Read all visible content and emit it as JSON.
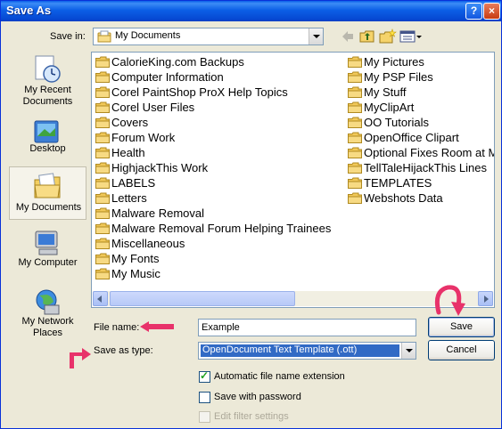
{
  "window": {
    "title": "Save As",
    "help_button": "?",
    "close_button": "×"
  },
  "toolbar": {
    "save_in_label": "Save in:",
    "save_in_value": "My Documents",
    "icons": [
      "back-icon",
      "up-folder-icon",
      "new-folder-icon",
      "views-menu-icon"
    ]
  },
  "places": [
    {
      "label": "My Recent Documents",
      "icon": "recent-documents-icon"
    },
    {
      "label": "Desktop",
      "icon": "desktop-icon"
    },
    {
      "label": "My Documents",
      "icon": "my-documents-icon",
      "selected": true
    },
    {
      "label": "My Computer",
      "icon": "my-computer-icon"
    },
    {
      "label": "My Network Places",
      "icon": "network-places-icon"
    }
  ],
  "files": {
    "column1": [
      "CalorieKing.com Backups",
      "Computer Information",
      "Corel PaintShop ProX Help Topics",
      "Corel User Files",
      "Covers",
      "Forum Work",
      "Health",
      "HighjackThis Work",
      "LABELS",
      "Letters",
      "Malware Removal",
      "Malware Removal Forum Helping Trainees",
      "Miscellaneous",
      "My Fonts",
      "My Music"
    ],
    "column2": [
      "My Pictures",
      "My PSP Files",
      "My Stuff",
      "MyClipArt",
      "OO Tutorials",
      "OpenOffice Clipart",
      "Optional Fixes Room at M",
      "TellTaleHijackThis Lines",
      "TEMPLATES",
      "Webshots Data"
    ]
  },
  "form": {
    "file_name_label": "File name:",
    "file_name_value": "Example",
    "save_as_type_label": "Save as type:",
    "save_as_type_value": "OpenDocument Text Template (.ott)",
    "save_button": "Save",
    "cancel_button": "Cancel",
    "auto_extension_label": "Automatic file name extension",
    "auto_extension_checked": true,
    "save_password_label": "Save with password",
    "save_password_checked": false,
    "edit_filter_label": "Edit filter settings",
    "edit_filter_enabled": false
  },
  "colors": {
    "title_bar": "#0a5ee8",
    "selection": "#316ac5",
    "annotation_arrow": "#e8326a"
  }
}
